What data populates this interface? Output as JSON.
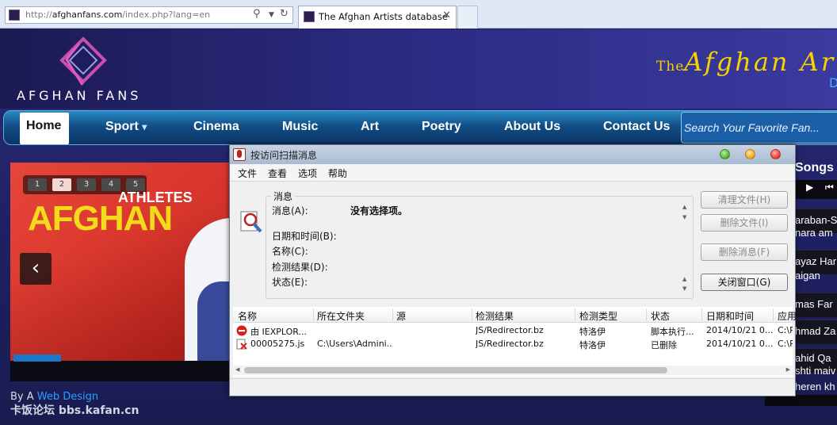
{
  "browser": {
    "url_prefix": "http://",
    "url_domain": "afghanfans.com",
    "url_path": "/index.php?lang=en",
    "tab_title": "The Afghan Artists database",
    "icons": [
      "search-icon",
      "dropdown-icon",
      "refresh-icon",
      "close-icon"
    ]
  },
  "site": {
    "logo_text": "AFGHAN FANS",
    "title_prefix": "The",
    "title_main": "Afghan  Ar",
    "title_sub": "D",
    "nav": [
      "Home",
      "Sport",
      "Cinema",
      "Music",
      "Art",
      "Poetry",
      "About Us",
      "Contact Us"
    ],
    "sport_arrow": "▾",
    "search_placeholder": "Search Your Favorite Fan...",
    "slider": {
      "pages": [
        "1",
        "2",
        "3",
        "4",
        "5"
      ],
      "active_page": "2",
      "overline": "ATHLETES",
      "headline": "AFGHAN",
      "prev_arrow": "‹"
    },
    "footer_prefix": "By A ",
    "footer_link": "Web Design",
    "watermark": "卡饭论坛 bbs.kafan.cn",
    "songs": {
      "heading": "Songs",
      "play": "▶",
      "prev": "⏮",
      "items": [
        "araban-S",
        "nara am",
        "ayaz Har",
        "aigan",
        "mas Far",
        "hmad Za",
        "ahid Qa",
        "shti maiv",
        "heren kh"
      ]
    }
  },
  "dialog": {
    "title": "按访问扫描消息",
    "menu": [
      "文件",
      "查看",
      "选项",
      "帮助"
    ],
    "group_title": "消息",
    "labels": {
      "message": "消息(A):",
      "datetime": "日期和时间(B):",
      "name": "名称(C):",
      "result": "检测结果(D):",
      "status": "状态(E):"
    },
    "message_value": "没有选择项。",
    "scroll_up": "▲",
    "scroll_down": "▼",
    "buttons": {
      "clean": "清理文件(H)",
      "delete_file": "删除文件(I)",
      "delete_msg": "删除消息(F)",
      "close": "关闭窗口(G)"
    },
    "columns": [
      "名称",
      "所在文件夹",
      "源",
      "检测结果",
      "检测类型",
      "状态",
      "日期和时间",
      "应用"
    ],
    "rows": [
      {
        "name": "由 IEXPLOR...",
        "folder": "",
        "source": "",
        "result": "JS/Redirector.bz",
        "type": "特洛伊",
        "status": "脚本执行...",
        "datetime": "2014/10/21 0...",
        "app": "C:\\P",
        "icon": "blocked-icon"
      },
      {
        "name": "00005275.js",
        "folder": "C:\\Users\\Admini...",
        "source": "",
        "result": "JS/Redirector.bz",
        "type": "特洛伊",
        "status": "已删除",
        "datetime": "2014/10/21 0...",
        "app": "C:\\P",
        "icon": "deleted-file-icon"
      }
    ],
    "hscroll_left": "◀",
    "hscroll_right": "▶"
  }
}
